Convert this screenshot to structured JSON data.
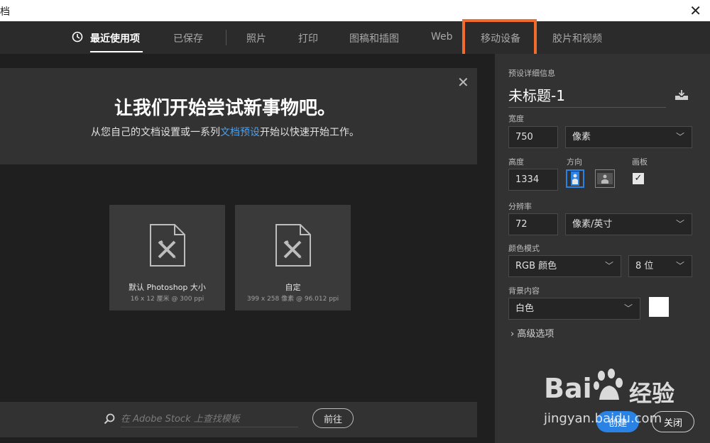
{
  "window": {
    "title": "档",
    "close_glyph": "✕"
  },
  "tabs": [
    {
      "label": "最近使用项",
      "active": true
    },
    {
      "label": "已保存"
    },
    {
      "label": "照片"
    },
    {
      "label": "打印"
    },
    {
      "label": "图稿和插图"
    },
    {
      "label": "Web"
    },
    {
      "label": "移动设备",
      "highlighted": true
    },
    {
      "label": "胶片和视频"
    }
  ],
  "banner": {
    "title": "让我们开始尝试新事物吧。",
    "subtitle_before": "从您自己的文档设置或一系列",
    "subtitle_link": "文档预设",
    "subtitle_after": "开始以快速开始工作。",
    "close_glyph": "✕"
  },
  "presets": [
    {
      "name": "默认 Photoshop 大小",
      "meta": "16 x 12 厘米 @ 300 ppi"
    },
    {
      "name": "自定",
      "meta": "399 x 258 像素 @ 96.012 ppi"
    }
  ],
  "search": {
    "placeholder": "在 Adobe Stock 上查找模板",
    "go_label": "前往"
  },
  "details": {
    "section_label": "预设详细信息",
    "doc_name": "未标题-1",
    "width_label": "宽度",
    "width_value": "750",
    "width_unit": "像素",
    "height_label": "高度",
    "height_value": "1334",
    "orientation_label": "方向",
    "artboard_label": "画板",
    "artboard_checked": true,
    "resolution_label": "分辨率",
    "resolution_value": "72",
    "resolution_unit": "像素/英寸",
    "color_mode_label": "颜色模式",
    "color_mode": "RGB 颜色",
    "bit_depth": "8 位",
    "background_label": "背景内容",
    "background": "白色",
    "background_color": "#ffffff",
    "advanced_label": "高级选项"
  },
  "footer": {
    "create_label": "创建",
    "close_label": "关闭"
  },
  "watermark": {
    "brand_left": "Bai",
    "brand_right": "经验",
    "url": "jingyan.baidu.com"
  },
  "colors": {
    "highlight": "#f26b2c",
    "accent": "#2a82e4",
    "link": "#4d9ee8"
  }
}
